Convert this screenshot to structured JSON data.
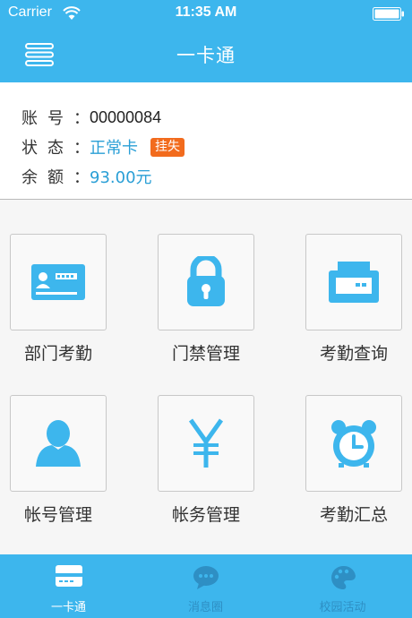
{
  "status_bar": {
    "carrier": "Carrier",
    "time": "11:35 AM"
  },
  "nav": {
    "title": "一卡通"
  },
  "info": {
    "account_label_1": "账",
    "account_label_2": "号",
    "account_value": "00000084",
    "status_label_1": "状",
    "status_label_2": "态",
    "status_value": "正常卡",
    "lost_button": "挂失",
    "balance_label_1": "余",
    "balance_label_2": "额",
    "balance_value": "93.00元",
    "colon": "："
  },
  "grid": [
    {
      "label": "部门考勤",
      "icon": "id-card-icon"
    },
    {
      "label": "门禁管理",
      "icon": "lock-icon"
    },
    {
      "label": "考勤查询",
      "icon": "printer-icon"
    },
    {
      "label": "帐号管理",
      "icon": "user-icon"
    },
    {
      "label": "帐务管理",
      "icon": "yen-icon"
    },
    {
      "label": "考勤汇总",
      "icon": "alarm-clock-icon"
    }
  ],
  "tabs": [
    {
      "label": "一卡通",
      "icon": "card-icon",
      "active": true
    },
    {
      "label": "消息圈",
      "icon": "chat-icon",
      "active": false
    },
    {
      "label": "校园活动",
      "icon": "palette-icon",
      "active": false
    }
  ],
  "colors": {
    "primary": "#3db6ed",
    "accent_blue": "#2a9fd6",
    "badge": "#f26b1d"
  }
}
